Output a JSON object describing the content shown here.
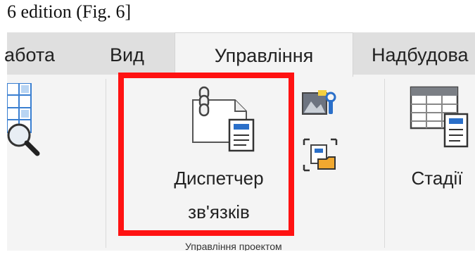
{
  "caption": "6 edition (Fig. 6]",
  "tabs": [
    {
      "label": "абота"
    },
    {
      "label": "Вид"
    },
    {
      "label": "Управління"
    },
    {
      "label": "Надбудова"
    }
  ],
  "ribbon": {
    "manage_links_button": {
      "line1": "Диспетчер",
      "line2": "зв'язків",
      "icon": "link-manager-icon"
    },
    "stages_button": {
      "label": "Стадії",
      "icon": "phases-table-icon"
    },
    "small_buttons": [
      {
        "icon": "image-settings-icon"
      },
      {
        "icon": "open-folder-icon"
      }
    ],
    "left_partial_icon": "zoom-grid-icon",
    "group_label": "Управління проектом"
  },
  "colors": {
    "highlight": "#ff1212",
    "accent_blue": "#2a6fc9",
    "tab_bar": "#dfdfdf",
    "ribbon_bg": "#f4f4f4"
  }
}
